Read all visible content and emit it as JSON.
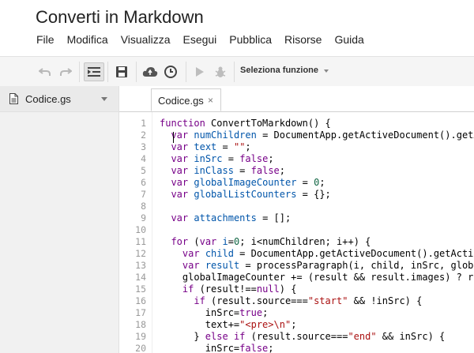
{
  "app": {
    "title": "Converti in Markdown"
  },
  "menu": [
    "File",
    "Modifica",
    "Visualizza",
    "Esegui",
    "Pubblica",
    "Risorse",
    "Guida"
  ],
  "toolbar": {
    "function_select": "Seleziona funzione"
  },
  "sidebar": {
    "file": "Codice.gs"
  },
  "tabs": [
    {
      "label": "Codice.gs",
      "close": "×"
    }
  ],
  "editor": {
    "line_numbers": [
      "1",
      "2",
      "3",
      "4",
      "5",
      "6",
      "7",
      "8",
      "9",
      "10",
      "11",
      "12",
      "13",
      "14",
      "15",
      "16",
      "17",
      "18",
      "19",
      "20"
    ],
    "lines": [
      "function ConvertToMarkdown() {",
      "  var numChildren = DocumentApp.getActiveDocument().getAc",
      "  var text = \"\";",
      "  var inSrc = false;",
      "  var inClass = false;",
      "  var globalImageCounter = 0;",
      "  var globalListCounters = {};",
      "",
      "  var attachments = [];",
      "",
      "  for (var i=0; i<numChildren; i++) {",
      "    var child = DocumentApp.getActiveDocument().getActive",
      "    var result = processParagraph(i, child, inSrc, global",
      "    globalImageCounter += (result && result.images) ? res",
      "    if (result!==null) {",
      "      if (result.source===\"start\" && !inSrc) {",
      "        inSrc=true;",
      "        text+=\"<pre>\\n\";",
      "      } else if (result.source===\"end\" && inSrc) {",
      "        inSrc=false;"
    ]
  }
}
